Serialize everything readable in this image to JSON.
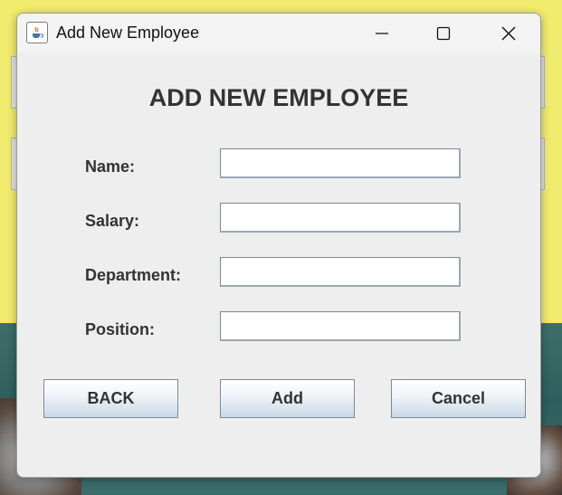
{
  "window": {
    "title": "Add New Employee",
    "controls": {
      "minimize": "minimize-icon",
      "maximize": "maximize-icon",
      "close": "close-icon"
    }
  },
  "form": {
    "heading": "ADD NEW EMPLOYEE",
    "fields": [
      {
        "label": "Name:",
        "value": ""
      },
      {
        "label": "Salary:",
        "value": ""
      },
      {
        "label": "Department:",
        "value": ""
      },
      {
        "label": "Position:",
        "value": ""
      }
    ]
  },
  "buttons": {
    "back": "BACK",
    "add": "Add",
    "cancel": "Cancel"
  },
  "colors": {
    "background_top": "#f2ec6e",
    "dialog_bg": "#eeeeee",
    "text": "#333333"
  }
}
